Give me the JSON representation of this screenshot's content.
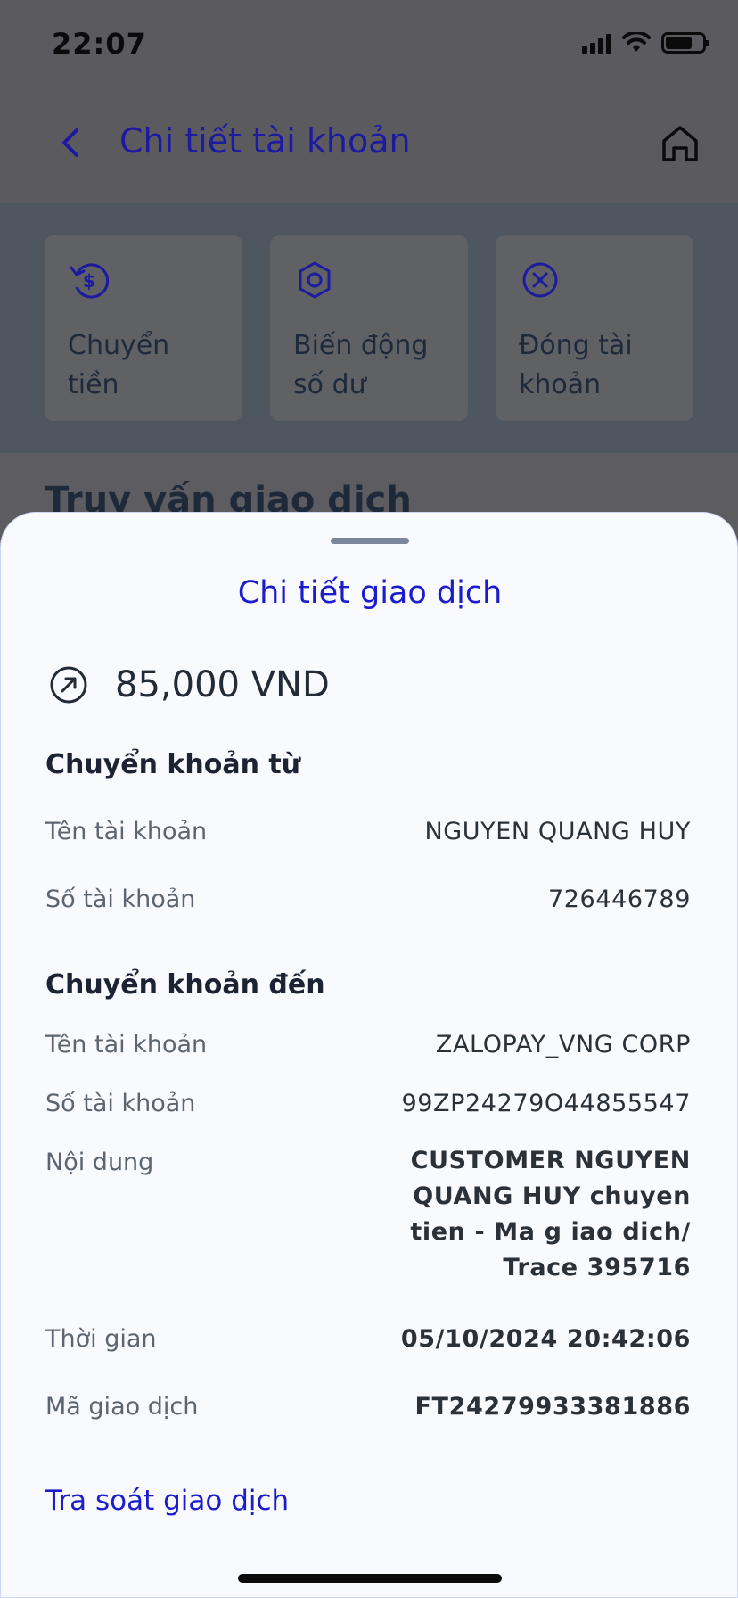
{
  "status_bar": {
    "time": "22:07"
  },
  "header": {
    "title": "Chi tiết tài khoản"
  },
  "actions": [
    {
      "label": "Chuyển tiền",
      "icon": "money-transfer-icon"
    },
    {
      "label": "Biến động số dư",
      "icon": "balance-change-icon"
    },
    {
      "label": "Đóng tài khoản",
      "icon": "close-account-icon"
    }
  ],
  "background_section": {
    "title": "Truy vấn giao dịch"
  },
  "sheet": {
    "title": "Chi tiết giao dịch",
    "amount": "85,000 VND",
    "from_section": {
      "heading": "Chuyển khoản từ",
      "account_name_label": "Tên tài khoản",
      "account_name": "NGUYEN QUANG HUY",
      "account_number_label": "Số tài khoản",
      "account_number": "726446789"
    },
    "to_section": {
      "heading": "Chuyển khoản đến",
      "account_name_label": "Tên tài khoản",
      "account_name": "ZALOPAY_VNG CORP",
      "account_number_label": "Số tài khoản",
      "account_number": "99ZP24279O44855547",
      "content_label": "Nội dung",
      "content": "CUSTOMER NGUYEN QUANG HUY chuyen tien - Ma g iao dich/ Trace 395716",
      "time_label": "Thời gian",
      "time": "05/10/2024 20:42:06",
      "transaction_id_label": "Mã giao dịch",
      "transaction_id": "FT24279933381886"
    },
    "trace_link": "Tra soát giao dịch"
  },
  "colors": {
    "accent": "#1c1ccc",
    "text_dark": "#1c2433",
    "text_muted": "#5d6570",
    "sheet_bg": "#f8fafd"
  }
}
